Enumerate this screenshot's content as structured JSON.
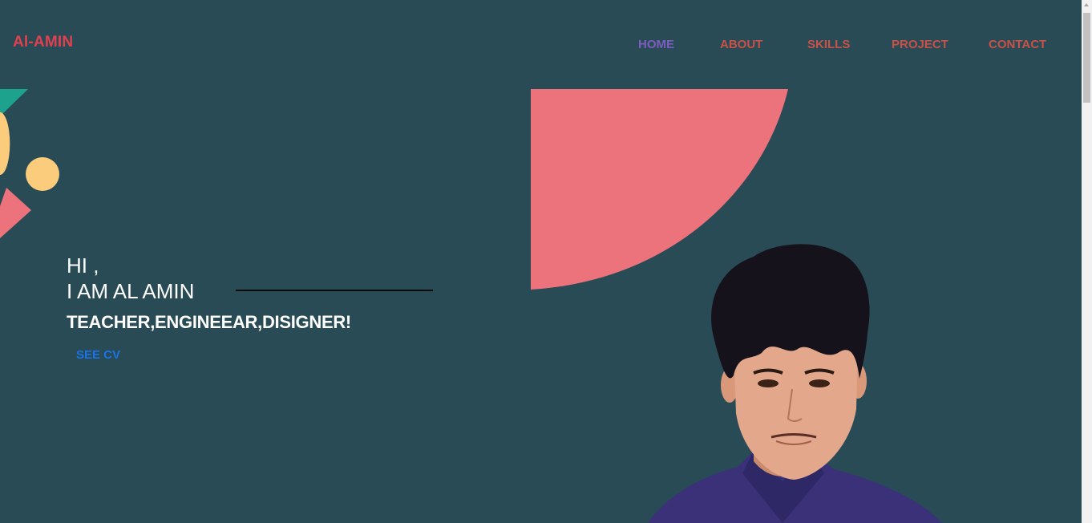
{
  "header": {
    "logo": "Al-AMIN"
  },
  "nav": {
    "items": [
      {
        "label": "HOME",
        "active": true
      },
      {
        "label": "ABOUT",
        "active": false
      },
      {
        "label": "SKILLS",
        "active": false
      },
      {
        "label": "PROJECT",
        "active": false
      },
      {
        "label": "CONTACT",
        "active": false
      }
    ]
  },
  "hero": {
    "greeting": "HI ,",
    "name": "I AM AL AMIN",
    "roles": "TEACHER,ENGINEEAR,DISIGNER!",
    "cta": "SEE CV"
  },
  "colors": {
    "background": "#294b55",
    "accent_coral": "#ec727b",
    "accent_yellow": "#fbcc7c",
    "accent_teal": "#1da38d",
    "logo": "#e0404f",
    "nav_text": "#c8514a",
    "nav_active": "#7d5cc0",
    "cta": "#1a73e8"
  }
}
